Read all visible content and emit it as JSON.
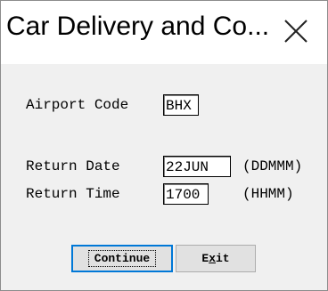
{
  "window": {
    "title": "Car Delivery and Co..."
  },
  "form": {
    "airport_code_label": "Airport Code",
    "airport_code_value": "BHX",
    "return_date_label": "Return Date",
    "return_date_value": "22JUN",
    "return_date_hint": "(DDMMM)",
    "return_time_label": "Return Time",
    "return_time_value": "1700",
    "return_time_hint": "(HHMM)"
  },
  "buttons": {
    "continue_label": "Continue",
    "exit_prefix": "E",
    "exit_mnemonic": "x",
    "exit_suffix": "it"
  },
  "colors": {
    "default_button_border": "#0078d7",
    "dialog_background": "#f0f0f0"
  }
}
